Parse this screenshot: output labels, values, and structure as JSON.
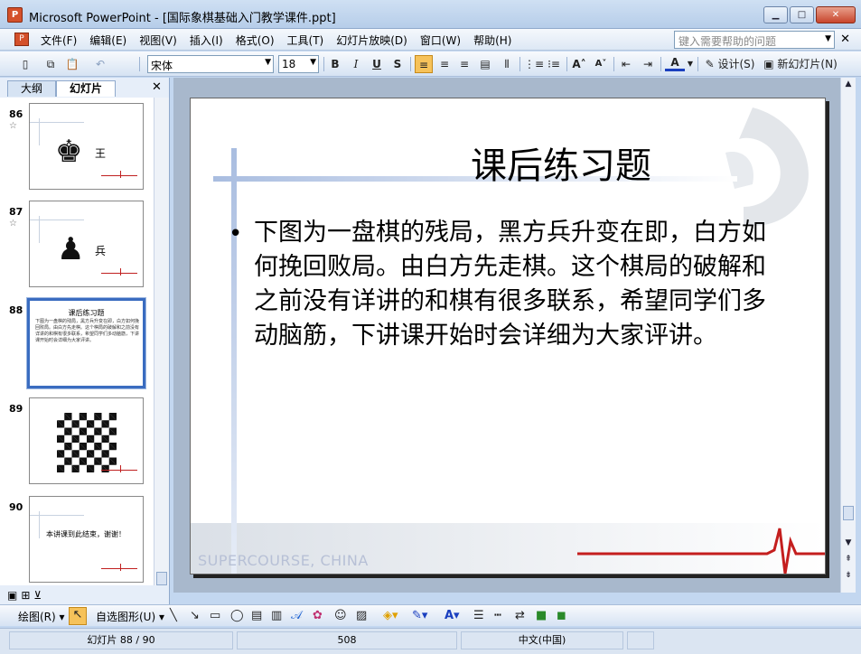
{
  "window": {
    "title": "Microsoft PowerPoint - [国际象棋基础入门教学课件.ppt]",
    "app_icon": "powerpoint-icon"
  },
  "menu": {
    "items": [
      "文件(F)",
      "编辑(E)",
      "视图(V)",
      "插入(I)",
      "格式(O)",
      "工具(T)",
      "幻灯片放映(D)",
      "窗口(W)",
      "帮助(H)"
    ],
    "help_placeholder": "键入需要帮助的问题"
  },
  "toolbar": {
    "font": "宋体",
    "font_size": "18",
    "bold": "B",
    "italic": "I",
    "underline": "U",
    "shadow": "S",
    "design_label": "设计(S)",
    "new_slide_label": "新幻灯片(N)"
  },
  "left_pane": {
    "tabs": [
      "大纲",
      "幻灯片"
    ],
    "active_tab": "幻灯片",
    "slides": [
      {
        "num": "86",
        "label": "王"
      },
      {
        "num": "87",
        "label": "兵"
      },
      {
        "num": "88",
        "mini_title": "课后练习题",
        "mini_text": "下图为一盘棋的残局，黑方兵升变在即，白方如何挽回败局。由白方先走棋。这个棋局的破解和之前没有详讲的和棋有很多联系，希望同学们多动脑筋，下讲课开始时会详细为大家评讲。"
      },
      {
        "num": "89"
      },
      {
        "num": "90",
        "label": "本讲课到此结束，谢谢！"
      }
    ]
  },
  "slide": {
    "title": "课后练习题",
    "body": "下图为一盘棋的残局，黑方兵升变在即，白方如何挽回败局。由白方先走棋。这个棋局的破解和之前没有详讲的和棋有很多联系，希望同学们多动脑筋，下讲课开始时会详细为大家评讲。",
    "footer": "SUPERCOURSE, CHINA"
  },
  "drawbar": {
    "draw_label": "绘图(R)",
    "autoshapes_label": "自选图形(U)"
  },
  "status": {
    "slide_info": "幻灯片 88 / 90",
    "design": "508",
    "language": "中文(中国)"
  }
}
